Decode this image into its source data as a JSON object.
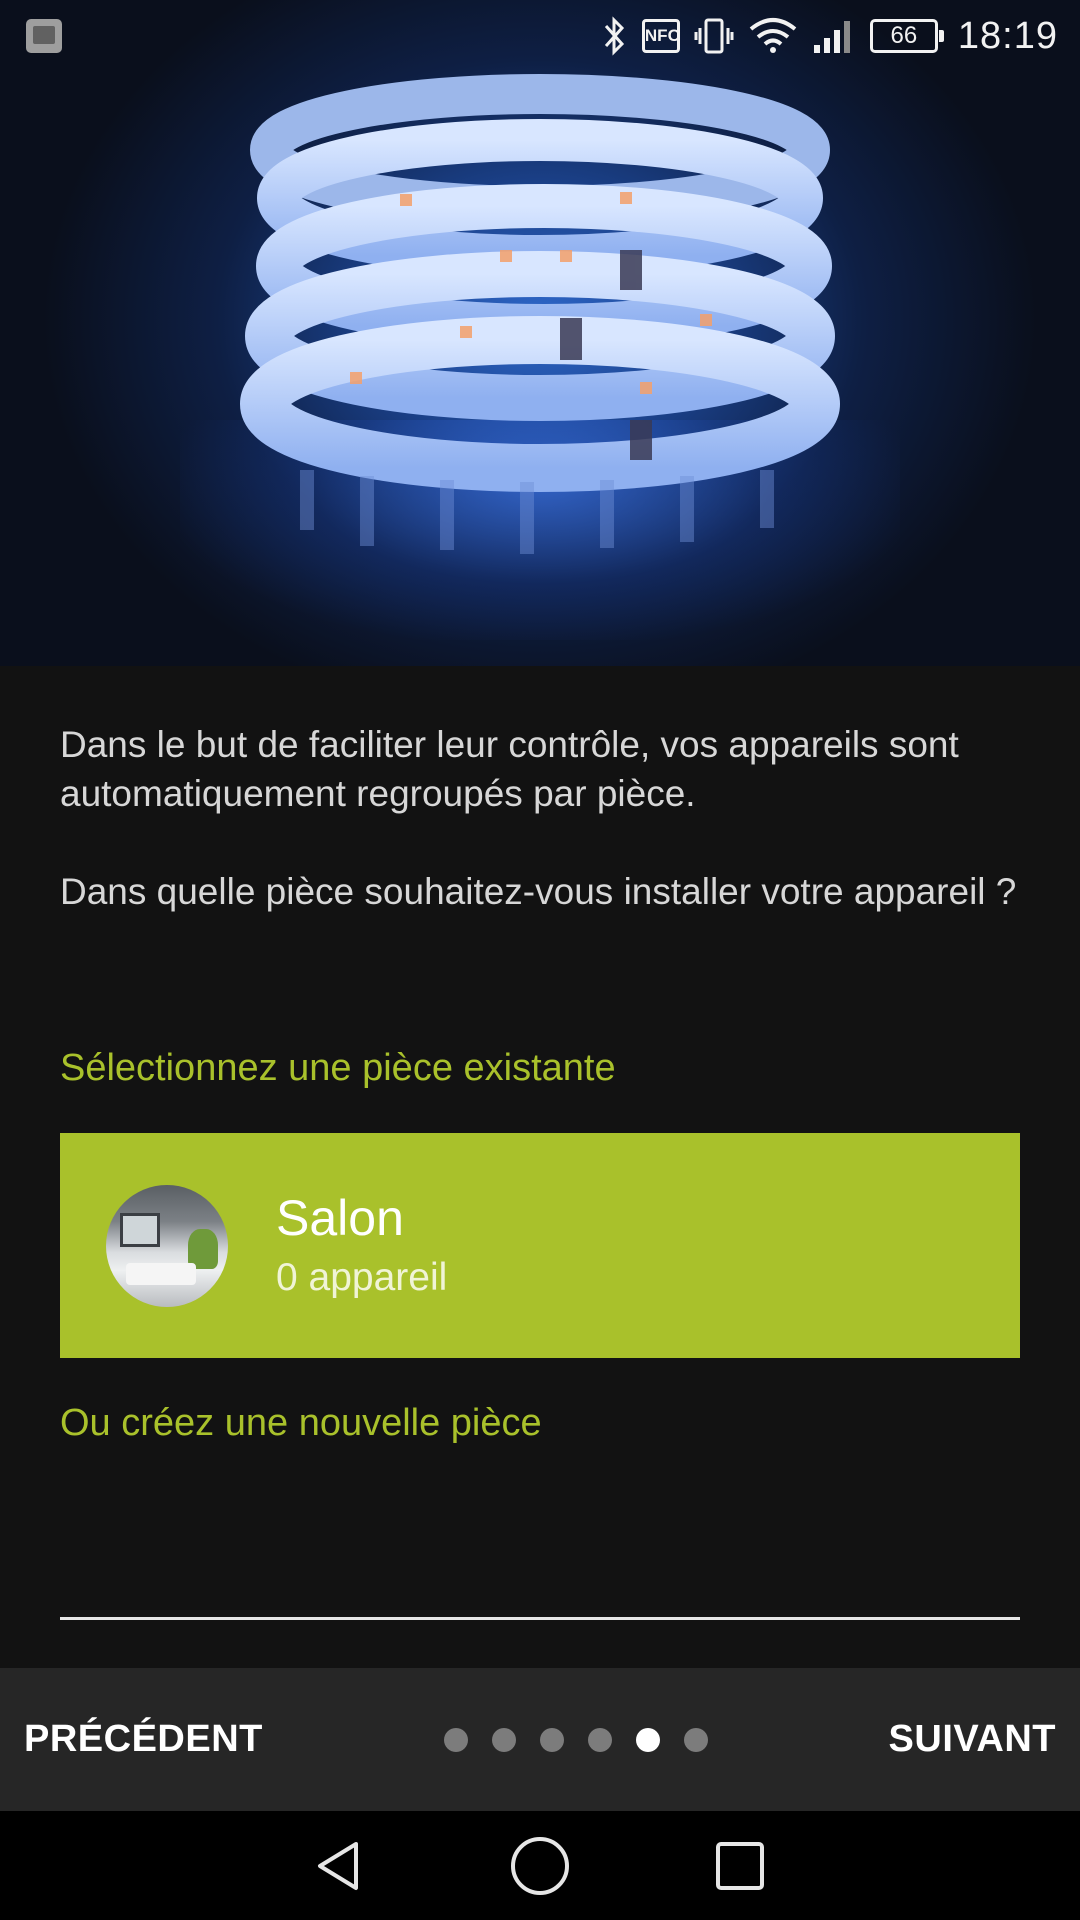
{
  "status_bar": {
    "time": "18:19",
    "battery": "66",
    "nfc_label": "NFC",
    "icons": [
      "gallery-icon",
      "bluetooth-icon",
      "nfc-icon",
      "vibrate-icon",
      "wifi-icon",
      "signal-icon",
      "battery-icon"
    ]
  },
  "hero": {
    "image": "led-strip-photo"
  },
  "intro": {
    "paragraph1": "Dans le but de faciliter leur contrôle, vos appareils sont automatiquement regroupés par pièce.",
    "paragraph2": "Dans quelle pièce souhaitez-vous installer votre appareil ?"
  },
  "existing_room": {
    "label": "Sélectionnez une pièce existante",
    "rooms": [
      {
        "name": "Salon",
        "count": "0 appareil"
      }
    ]
  },
  "new_room": {
    "label": "Ou créez une nouvelle pièce",
    "value": "",
    "placeholder": ""
  },
  "wizard": {
    "prev_label": "PRÉCÉDENT",
    "next_label": "SUIVANT",
    "step_total": 6,
    "step_current": 5
  },
  "colors": {
    "accent": "#a9c12b",
    "background": "#121212",
    "bar": "#262626"
  }
}
